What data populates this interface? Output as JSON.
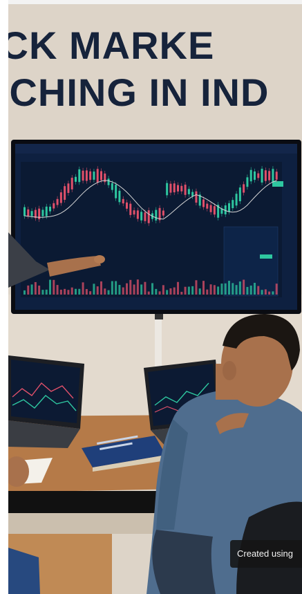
{
  "poster": {
    "headline_line1": "OCK MARKE",
    "headline_line2": "ACHING IN IND"
  },
  "badge": {
    "label": "Created using"
  },
  "colors": {
    "headline": "#16233b",
    "wall": "#ddd4c8",
    "screen_bg": "#0b1a33",
    "candle_up": "#2ec7a0",
    "candle_down": "#e0506a",
    "desk": "#b57a48",
    "book": "#1f3f7a"
  }
}
